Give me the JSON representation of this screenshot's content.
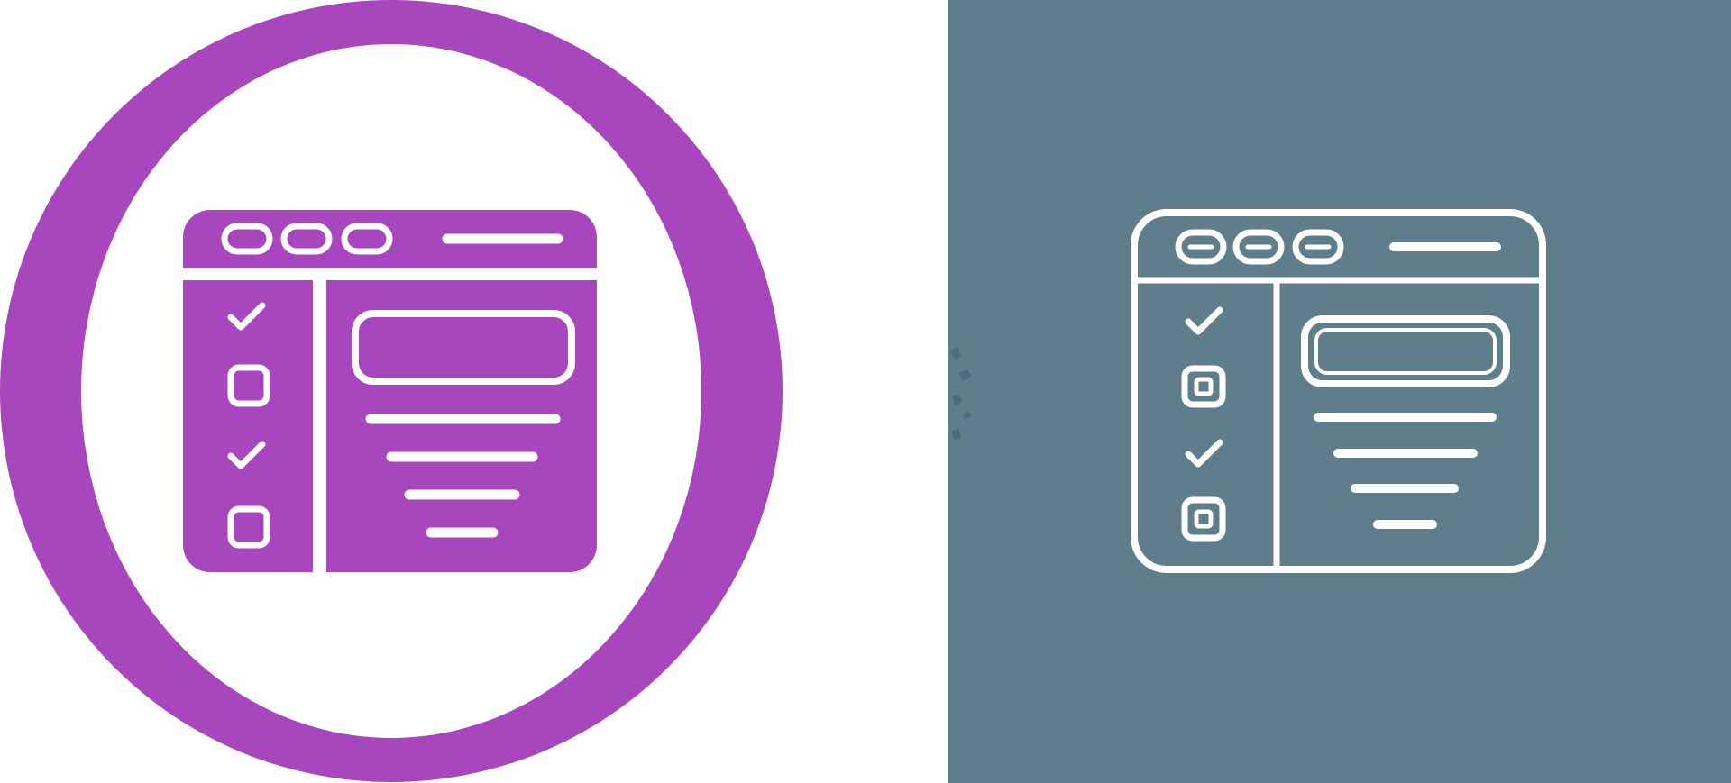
{
  "colors": {
    "background": "#ffffff",
    "accent_purple": "#a847bd",
    "slate_panel": "#607d8b",
    "icon_line": "#ffffff"
  },
  "icons": {
    "left": "checklist-browser-window-glyph-icon",
    "right": "checklist-browser-window-line-icon",
    "badge": "double-ring-circle-badge"
  }
}
